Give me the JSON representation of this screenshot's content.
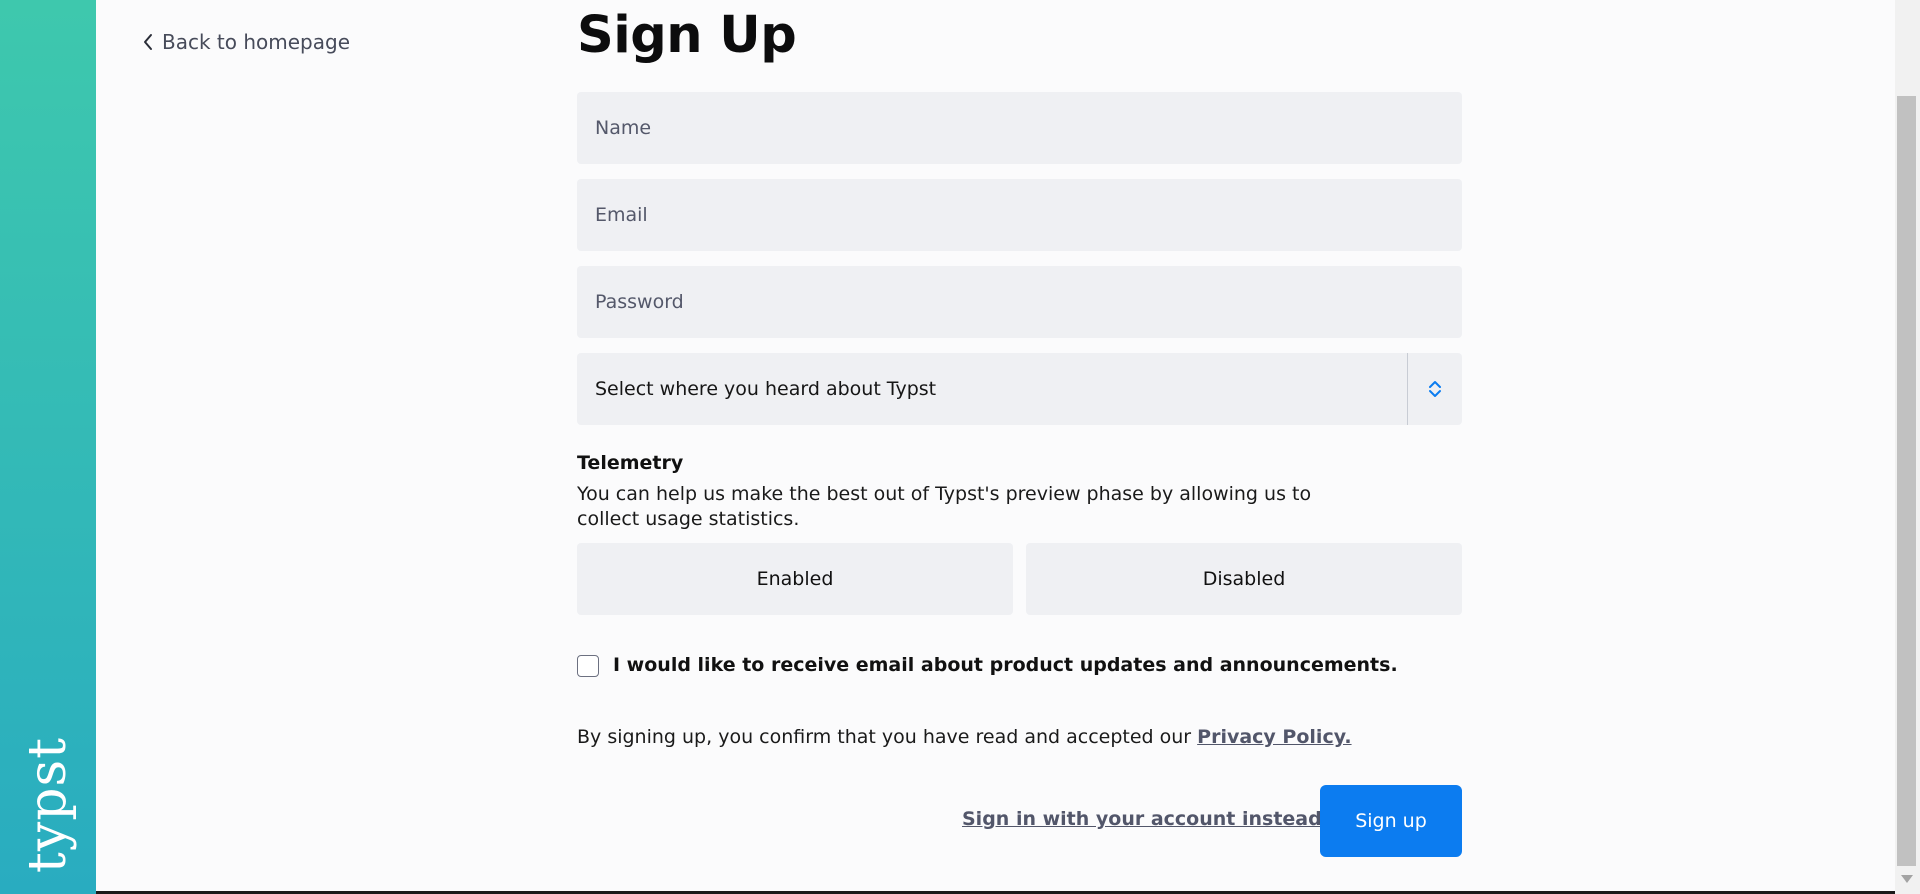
{
  "brand": {
    "logo_text": "typst",
    "color_top": "#3ec8ad",
    "color_bottom": "#29acc0"
  },
  "nav": {
    "back_label": "Back to homepage"
  },
  "form": {
    "title": "Sign Up",
    "name_placeholder": "Name",
    "email_placeholder": "Email",
    "password_placeholder": "Password",
    "source_select_label": "Select where you heard about Typst",
    "telemetry": {
      "title": "Telemetry",
      "description": "You can help us make the best out of Typst's preview phase by allowing us to collect usage statistics.",
      "enabled_label": "Enabled",
      "disabled_label": "Disabled"
    },
    "newsletter_label": "I would like to receive email about product updates and announcements.",
    "consent_text": "By signing up, you confirm that you have read and accepted our ",
    "privacy_link": "Privacy Policy.",
    "signin_link": "Sign in with your account instead",
    "submit_label": "Sign up"
  },
  "colors": {
    "primary": "#0c7cf0",
    "field_bg": "#eff0f3"
  }
}
